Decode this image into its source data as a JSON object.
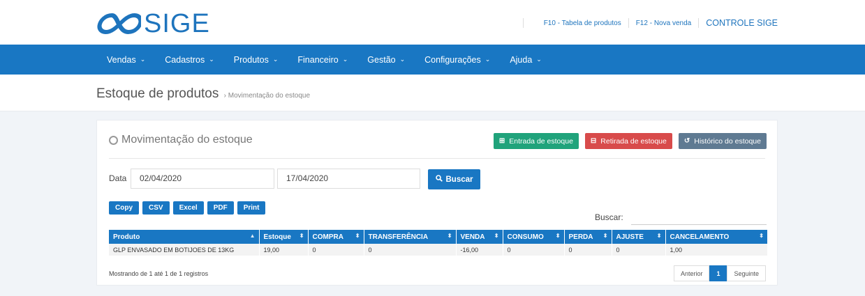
{
  "brand": {
    "name": "SIGE"
  },
  "toplinks": {
    "f10": "F10 - Tabela de produtos",
    "f12": "F12 - Nova venda",
    "control": "CONTROLE SIGE"
  },
  "nav": [
    {
      "label": "Vendas"
    },
    {
      "label": "Cadastros"
    },
    {
      "label": "Produtos"
    },
    {
      "label": "Financeiro"
    },
    {
      "label": "Gestão"
    },
    {
      "label": "Configurações"
    },
    {
      "label": "Ajuda"
    }
  ],
  "page": {
    "title": "Estoque de produtos",
    "crumb": "› Movimentação do estoque"
  },
  "card": {
    "title": "Movimentação do estoque",
    "actions": {
      "entrada": "Entrada de estoque",
      "retirada": "Retirada de estoque",
      "historico": "Histórico do estoque"
    },
    "date_label": "Data",
    "date_from": "02/04/2020",
    "date_to": "17/04/2020",
    "search_button": "Buscar",
    "export": [
      "Copy",
      "CSV",
      "Excel",
      "PDF",
      "Print"
    ],
    "buscar_label": "Buscar:"
  },
  "table": {
    "headers": [
      "Produto",
      "Estoque",
      "COMPRA",
      "TRANSFERÊNCIA",
      "VENDA",
      "CONSUMO",
      "PERDA",
      "AJUSTE",
      "CANCELAMENTO"
    ],
    "rows": [
      [
        "GLP ENVASADO EM BOTIJOES DE 13KG",
        "19,00",
        "0",
        "0",
        "-16,00",
        "0",
        "0",
        "0",
        "1,00"
      ]
    ]
  },
  "footer": {
    "info": "Mostrando de 1 até 1 de 1 registros",
    "prev": "Anterior",
    "page": "1",
    "next": "Seguinte"
  },
  "colors": {
    "primary": "#1977c3",
    "green": "#20a37b",
    "red": "#d84b4b",
    "gray": "#5f7a92"
  }
}
